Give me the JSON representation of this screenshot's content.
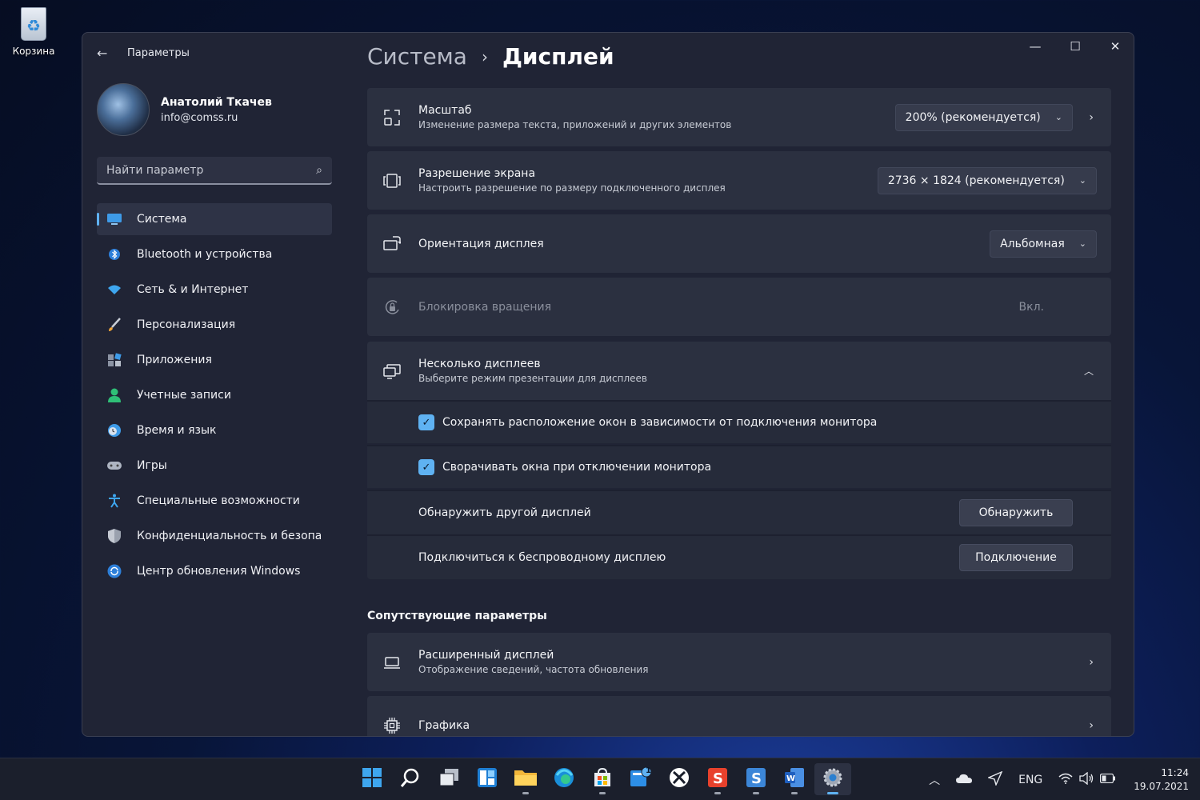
{
  "desktop": {
    "recycle_bin_label": "Корзина"
  },
  "window": {
    "app_title": "Параметры",
    "controls": {
      "minimize": "—",
      "maximize": "☐",
      "close": "✕"
    }
  },
  "profile": {
    "name": "Анатолий Ткачев",
    "email": "info@comss.ru"
  },
  "search": {
    "placeholder": "Найти параметр"
  },
  "nav": {
    "items": [
      {
        "label": "Система",
        "icon": "system-icon",
        "active": true
      },
      {
        "label": "Bluetooth и устройства",
        "icon": "bluetooth-icon"
      },
      {
        "label": "Сеть & и Интернет",
        "icon": "wifi-icon"
      },
      {
        "label": "Персонализация",
        "icon": "brush-icon"
      },
      {
        "label": "Приложения",
        "icon": "apps-icon"
      },
      {
        "label": "Учетные записи",
        "icon": "accounts-icon"
      },
      {
        "label": "Время и язык",
        "icon": "time-language-icon"
      },
      {
        "label": "Игры",
        "icon": "gamepad-icon"
      },
      {
        "label": "Специальные возможности",
        "icon": "accessibility-icon"
      },
      {
        "label": "Конфиденциальность и безопасность",
        "icon": "shield-icon"
      },
      {
        "label": "Центр обновления Windows",
        "icon": "update-icon"
      }
    ]
  },
  "breadcrumb": {
    "parent": "Система",
    "separator": "›",
    "current": "Дисплей"
  },
  "settings": {
    "scale": {
      "title": "Масштаб",
      "subtitle": "Изменение размера текста, приложений и других элементов",
      "value": "200% (рекомендуется)"
    },
    "resolution": {
      "title": "Разрешение экрана",
      "subtitle": "Настроить  разрешение  по  размеру  подключенного  дисплея",
      "value": "2736 × 1824 (рекомендуется)"
    },
    "orientation": {
      "title": "Ориентация дисплея",
      "value": "Альбомная"
    },
    "rotation_lock": {
      "title": "Блокировка вращения",
      "value": "Вкл."
    },
    "multiple_displays": {
      "title": "Несколько дисплеев",
      "subtitle": "Выберите режим презентации для дисплеев",
      "remember_windows": "Сохранять расположение окон в зависимости от подключения монитора",
      "minimize_windows": "Сворачивать окна при отключении монитора",
      "detect_label": "Обнаружить другой дисплей",
      "detect_button": "Обнаружить",
      "connect_label": "Подключиться к беспроводному дисплею",
      "connect_button": "Подключение"
    }
  },
  "related": {
    "title": "Сопутствующие параметры",
    "advanced": {
      "title": "Расширенный дисплей",
      "subtitle": "Отображение сведений, частота обновления"
    },
    "graphics": {
      "title": "Графика"
    }
  },
  "taskbar": {
    "apps": [
      "start-icon",
      "search-icon",
      "task-view-icon",
      "widgets-icon",
      "explorer-icon",
      "edge-icon",
      "store-icon",
      "notification-app-icon",
      "xbox-icon",
      "app-s-red-icon",
      "app-s-blue-icon",
      "word-icon",
      "settings-icon"
    ],
    "badge": "1",
    "language": "ENG",
    "time": "11:24",
    "date": "19.07.2021"
  },
  "colors": {
    "accent": "#5fb2f2",
    "window_bg": "#202435",
    "card_bg": "#2b3040"
  }
}
